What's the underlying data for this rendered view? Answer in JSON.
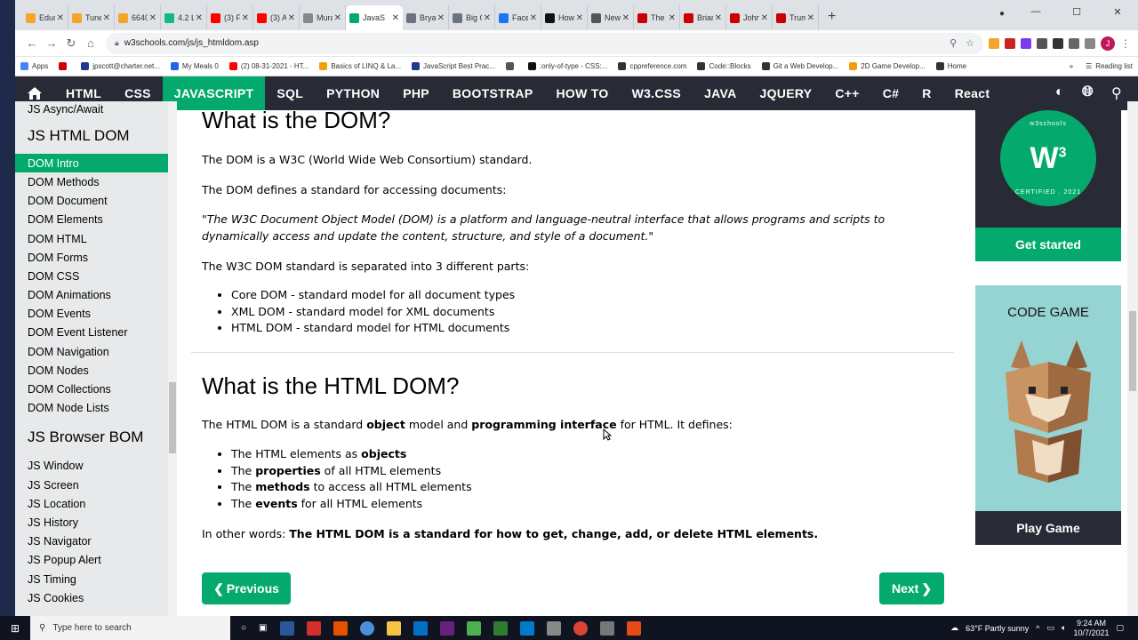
{
  "tabs": [
    {
      "label": "Educ",
      "color": "#f4a52a"
    },
    {
      "label": "Tune",
      "color": "#f4a52a"
    },
    {
      "label": "6640",
      "color": "#f4a52a"
    },
    {
      "label": "4.2 La",
      "color": "#10b981"
    },
    {
      "label": "(3) Fu",
      "color": "#ff0000"
    },
    {
      "label": "(3) A",
      "color": "#ff0000"
    },
    {
      "label": "Mura",
      "color": "#888888"
    },
    {
      "label": "JavaS",
      "color": "#04aa6d",
      "active": true
    },
    {
      "label": "Bryan",
      "color": "#6b7280"
    },
    {
      "label": "Big G",
      "color": "#6b7280"
    },
    {
      "label": "Faceb",
      "color": "#1877f2"
    },
    {
      "label": "How",
      "color": "#111111"
    },
    {
      "label": "New",
      "color": "#555555"
    },
    {
      "label": "The",
      "color": "#cc0000"
    },
    {
      "label": "Brian",
      "color": "#cc0000"
    },
    {
      "label": "John",
      "color": "#cc0000"
    },
    {
      "label": "Trum",
      "color": "#cc0000"
    }
  ],
  "address": {
    "url": "w3schools.com/js/js_htmldom.asp"
  },
  "bookmarks": [
    {
      "label": "Apps",
      "color": "#4285f4"
    },
    {
      "label": "",
      "color": "#cc0000"
    },
    {
      "label": "jpscott@charter.net...",
      "color": "#1e3a8a"
    },
    {
      "label": "My Meals 0",
      "color": "#2563eb"
    },
    {
      "label": "(2) 08-31-2021 - HT...",
      "color": "#ff0000"
    },
    {
      "label": "Basics of LINQ & La...",
      "color": "#f59e0b"
    },
    {
      "label": "JavaScript Best Prac...",
      "color": "#1e3a8a"
    },
    {
      "label": "",
      "color": "#555555"
    },
    {
      "label": ":only-of-type - CSS:...",
      "color": "#111111"
    },
    {
      "label": "cppreference.com",
      "color": "#333333"
    },
    {
      "label": "Code::Blocks",
      "color": "#333333"
    },
    {
      "label": "Git a Web Develop...",
      "color": "#333333"
    },
    {
      "label": "2D Game Develop...",
      "color": "#f59e0b"
    },
    {
      "label": "Home",
      "color": "#333333"
    }
  ],
  "reading_list": "Reading list",
  "nav": {
    "items": [
      "HTML",
      "CSS",
      "JAVASCRIPT",
      "SQL",
      "PYTHON",
      "PHP",
      "BOOTSTRAP",
      "HOW TO",
      "W3.CSS",
      "JAVA",
      "JQUERY",
      "C++",
      "C#",
      "R",
      "React"
    ],
    "active": "JAVASCRIPT"
  },
  "sidebar": {
    "top_link": "JS Async/Await",
    "section1": "JS HTML DOM",
    "dom_links": [
      "DOM Intro",
      "DOM Methods",
      "DOM Document",
      "DOM Elements",
      "DOM HTML",
      "DOM Forms",
      "DOM CSS",
      "DOM Animations",
      "DOM Events",
      "DOM Event Listener",
      "DOM Navigation",
      "DOM Nodes",
      "DOM Collections",
      "DOM Node Lists"
    ],
    "active": "DOM Intro",
    "section2": "JS Browser BOM",
    "bom_links": [
      "JS Window",
      "JS Screen",
      "JS Location",
      "JS History",
      "JS Navigator",
      "JS Popup Alert",
      "JS Timing",
      "JS Cookies"
    ]
  },
  "content": {
    "h1": "What is the DOM?",
    "p1": "The DOM is a W3C (World Wide Web Consortium) standard.",
    "p2": "The DOM defines a standard for accessing documents:",
    "quote_line1": "\"The W3C Document Object Model (DOM) is a platform and language-neutral interface that allows programs and scripts to",
    "quote_line2": "dynamically access and update the content, structure, and style of a document.\"",
    "p3": "The W3C DOM standard is separated into 3 different parts:",
    "parts": [
      "Core DOM - standard model for all document types",
      "XML DOM - standard model for XML documents",
      "HTML DOM - standard model for HTML documents"
    ],
    "h2": "What is the HTML DOM?",
    "p4_a": "The HTML DOM is a standard ",
    "p4_b": "object",
    "p4_c": " model and ",
    "p4_d": "programming interface",
    "p4_e": " for HTML. It defines:",
    "defines": [
      {
        "pre": "The HTML elements as ",
        "bold": "objects",
        "post": ""
      },
      {
        "pre": "The ",
        "bold": "properties",
        "post": " of all HTML elements"
      },
      {
        "pre": "The ",
        "bold": "methods",
        "post": " to access all HTML elements"
      },
      {
        "pre": "The ",
        "bold": "events",
        "post": " for all HTML elements"
      }
    ],
    "p5_a": "In other words: ",
    "p5_b": "The HTML DOM is a standard for how to get, change, add, or delete HTML elements.",
    "prev": "Previous",
    "next": "Next"
  },
  "ads": {
    "logo_top": "w3schools",
    "logo_bottom": "CERTIFIED . 2021",
    "get_started": "Get started",
    "code_game": "CODE GAME",
    "play_game": "Play Game"
  },
  "taskbar": {
    "search_placeholder": "Type here to search",
    "weather": "63°F  Partly sunny",
    "time": "9:24 AM",
    "date": "10/7/2021"
  }
}
